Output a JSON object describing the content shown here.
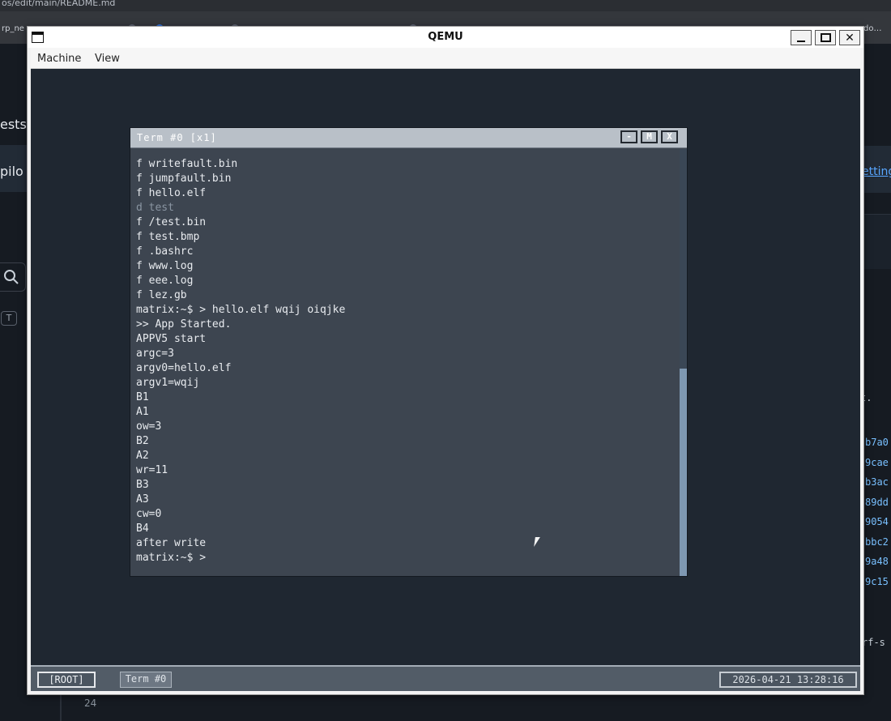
{
  "background": {
    "topbar_text": "os/edit/main/README.md",
    "tab_texts": [
      "rp_ne",
      "…",
      "…",
      "…",
      "…",
      "…",
      "…",
      "…",
      "do…"
    ],
    "left_texts": [
      "ests",
      "pilo"
    ],
    "search_key": "T",
    "right_link": "etting",
    "right_dot_text": "t.",
    "right_hashes": [
      "b7a0",
      "9cae",
      "b3ac",
      "89dd",
      "9054",
      "bbc2",
      "9a48",
      "9c15"
    ],
    "right_bottom_text": "rf-s",
    "line_number": "24"
  },
  "qemu": {
    "title": "QEMU",
    "menu": [
      "Machine",
      "View"
    ],
    "controls": {
      "minimize": "",
      "maximize": "",
      "close": "✕"
    }
  },
  "terminal": {
    "title": "Term #0 [x1]",
    "buttons": {
      "minimize": "-",
      "maximize": "M",
      "close": "X"
    },
    "lines": [
      {
        "text": "f writefault.bin",
        "dim": false
      },
      {
        "text": "f jumpfault.bin",
        "dim": false
      },
      {
        "text": "f hello.elf",
        "dim": false
      },
      {
        "text": "d test",
        "dim": true
      },
      {
        "text": "f /test.bin",
        "dim": false
      },
      {
        "text": "f test.bmp",
        "dim": false
      },
      {
        "text": "f .bashrc",
        "dim": false
      },
      {
        "text": "f www.log",
        "dim": false
      },
      {
        "text": "f eee.log",
        "dim": false
      },
      {
        "text": "f lez.gb",
        "dim": false
      },
      {
        "text": "matrix:~$ > hello.elf wqij oiqjke",
        "dim": false
      },
      {
        "text": ">> App Started.",
        "dim": false
      },
      {
        "text": "APPV5 start",
        "dim": false
      },
      {
        "text": "argc=3",
        "dim": false
      },
      {
        "text": "argv0=hello.elf",
        "dim": false
      },
      {
        "text": "argv1=wqij",
        "dim": false
      },
      {
        "text": "B1",
        "dim": false
      },
      {
        "text": "A1",
        "dim": false
      },
      {
        "text": "ow=3",
        "dim": false
      },
      {
        "text": "B2",
        "dim": false
      },
      {
        "text": "A2",
        "dim": false
      },
      {
        "text": "wr=11",
        "dim": false
      },
      {
        "text": "B3",
        "dim": false
      },
      {
        "text": "A3",
        "dim": false
      },
      {
        "text": "cw=0",
        "dim": false
      },
      {
        "text": "B4",
        "dim": false
      },
      {
        "text": "after write",
        "dim": false
      },
      {
        "text": "matrix:~$ >",
        "dim": false
      }
    ]
  },
  "taskbar": {
    "root_label": "[ROOT]",
    "term_label": "Term #0",
    "clock": "2026-04-21 13:28:16"
  }
}
